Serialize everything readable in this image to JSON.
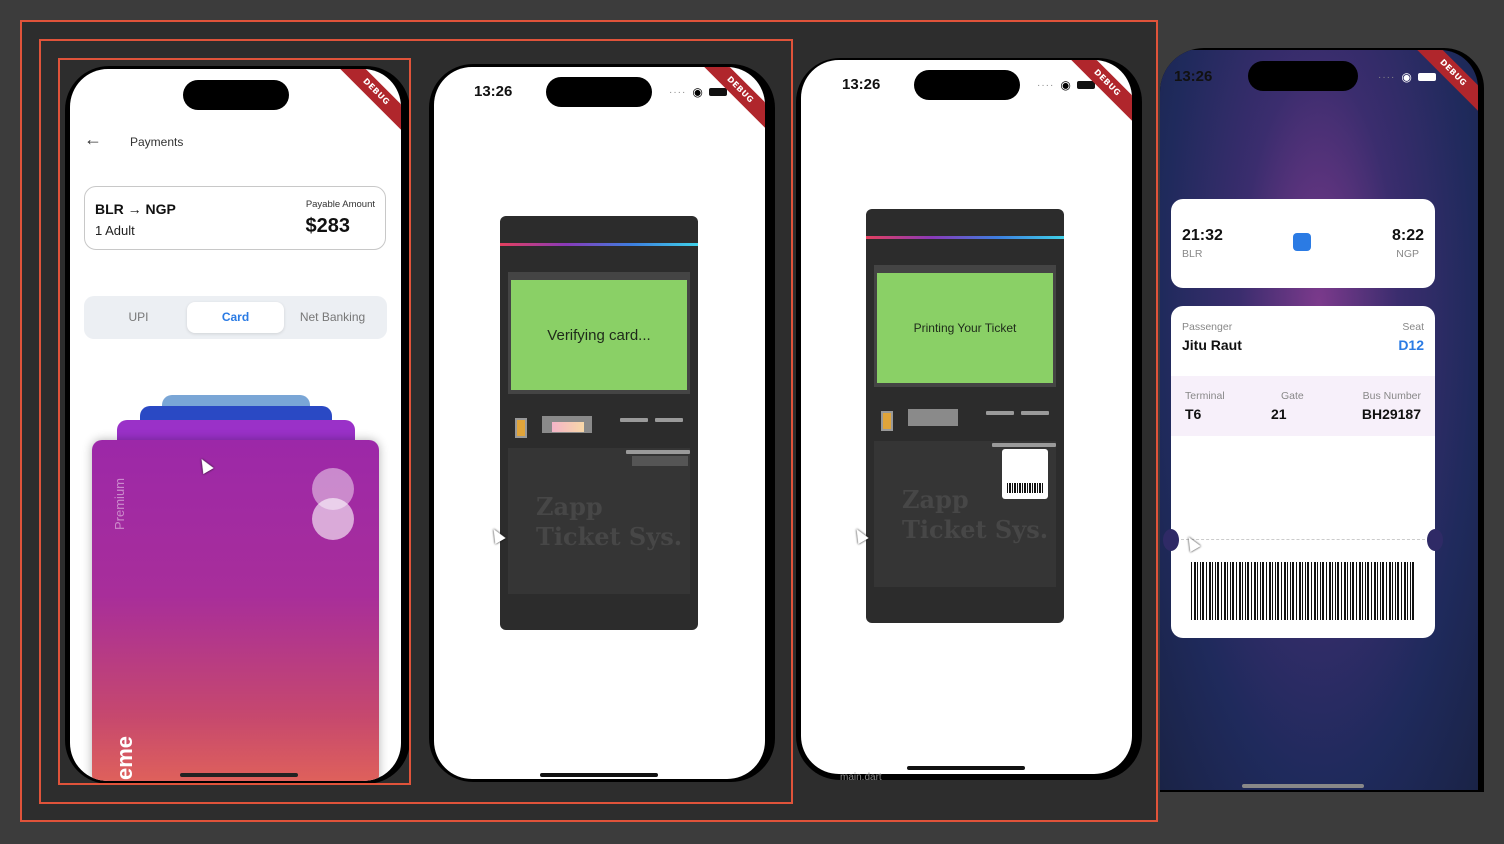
{
  "payments": {
    "back_icon": "arrow-left-icon",
    "title": "Payments",
    "route": "BLR → NGP",
    "passengers": "1 Adult",
    "payable_label": "Payable Amount",
    "amount": "$283",
    "tabs": [
      {
        "label": "UPI",
        "active": false
      },
      {
        "label": "Card",
        "active": true
      },
      {
        "label": "Net Banking",
        "active": false
      }
    ],
    "card_label": "Premium",
    "card_brand": "eme"
  },
  "verify": {
    "time": "13:26",
    "screen_text": "Verifying card...",
    "brand_line1": "Zapp",
    "brand_line2": "Ticket Sys."
  },
  "printing": {
    "time": "13:26",
    "screen_text": "Printing Your Ticket",
    "brand_line1": "Zapp",
    "brand_line2": "Ticket Sys.",
    "behind_text": "main.dart"
  },
  "ticket": {
    "time": "13:26",
    "depart_time": "21:32",
    "depart_code": "BLR",
    "arrive_time": "8:22",
    "arrive_code": "NGP",
    "bus_icon": "bus-icon",
    "passenger_label": "Passenger",
    "passenger_name": "Jitu Raut",
    "seat_label": "Seat",
    "seat_value": "D12",
    "terminal_label": "Terminal",
    "terminal_value": "T6",
    "gate_label": "Gate",
    "gate_value": "21",
    "bus_number_label": "Bus Number",
    "bus_number_value": "BH29187"
  },
  "debug_banner": "DEBUG",
  "colors": {
    "accent": "#2b7be4",
    "selection": "#e0533a",
    "kiosk_screen": "#8ad066"
  }
}
